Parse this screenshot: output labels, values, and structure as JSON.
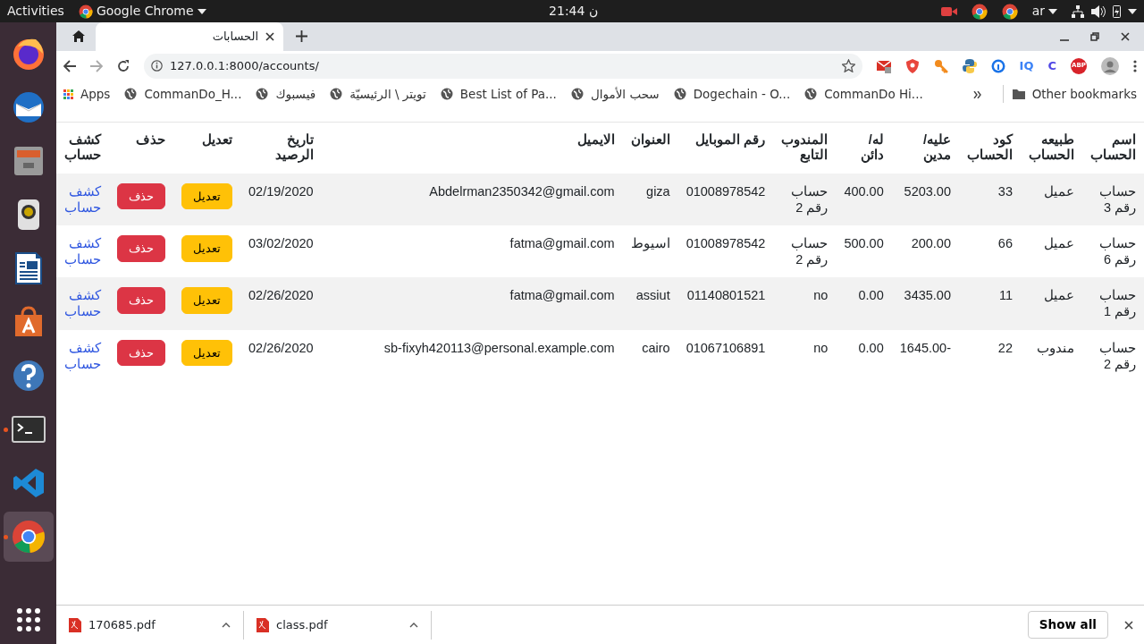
{
  "top_bar": {
    "activities": "Activities",
    "app": "Google Chrome",
    "clock": "ن 21:44",
    "language": "ar"
  },
  "dock": {
    "items": [
      {
        "kind": "firefox",
        "running": false,
        "selected": false
      },
      {
        "kind": "mail",
        "running": false,
        "selected": false
      },
      {
        "kind": "files",
        "running": false,
        "selected": false
      },
      {
        "kind": "speaker",
        "running": false,
        "selected": false
      },
      {
        "kind": "writer",
        "running": false,
        "selected": false
      },
      {
        "kind": "store",
        "running": false,
        "selected": false
      },
      {
        "kind": "help",
        "running": false,
        "selected": false
      },
      {
        "kind": "terminal",
        "running": true,
        "selected": false
      },
      {
        "kind": "code",
        "running": false,
        "selected": false
      },
      {
        "kind": "chrome",
        "running": true,
        "selected": true
      }
    ]
  },
  "tabs": [
    {
      "label": "الحسابات",
      "selected": true
    }
  ],
  "address": "127.0.0.1:8000/accounts/",
  "extensions": [
    {
      "kind": "stop",
      "label": "ABP",
      "color": "#d8232a"
    },
    {
      "kind": "label",
      "label": "C",
      "color": "#4f46e5"
    },
    {
      "kind": "label",
      "label": "IQ",
      "color": "#3b82f6"
    },
    {
      "kind": "info"
    },
    {
      "kind": "python"
    },
    {
      "kind": "key"
    },
    {
      "kind": "shield"
    },
    {
      "kind": "mail"
    }
  ],
  "bookmarks": {
    "apps": "Apps",
    "items": [
      "CommanDo Hi...",
      "Dogechain - O...",
      "سحب الأموال",
      "Best List of Pa...",
      "تويتر \\ الرئيسيّة",
      "فيسبوك",
      "CommanDo_H..."
    ],
    "other": "Other bookmarks"
  },
  "table": {
    "columns": [
      "اسم الحساب",
      "طبيعه الحساب",
      "كود الحساب",
      "عليه/ مدين",
      "له/ دائن",
      "المندوب التابع",
      "رقم الموبايل",
      "العنوان",
      "الايميل",
      "تاريخ الرصيد",
      "تعديل",
      "حذف",
      "كشف حساب"
    ],
    "rows": [
      {
        "cells": [
          "حساب رقم 3",
          "عميل",
          "33",
          "5203.00",
          "400.00",
          "حساب رقم 2",
          "01008978542",
          "giza",
          "Abdelrman2350342@gmail.com",
          "02/19/2020"
        ],
        "edit": "تعديل",
        "delete": "حذف",
        "statement": "كشف حساب"
      },
      {
        "cells": [
          "حساب رقم 6",
          "عميل",
          "66",
          "200.00",
          "500.00",
          "حساب رقم 2",
          "01008978542",
          "اسيوط",
          "fatma@gmail.com",
          "03/02/2020"
        ],
        "edit": "تعديل",
        "delete": "حذف",
        "statement": "كشف حساب"
      },
      {
        "cells": [
          "حساب رقم 1",
          "عميل",
          "11",
          "3435.00",
          "0.00",
          "no",
          "01140801521",
          "assiut",
          "fatma@gmail.com",
          "02/26/2020"
        ],
        "edit": "تعديل",
        "delete": "حذف",
        "statement": "كشف حساب"
      },
      {
        "cells": [
          "حساب رقم 2",
          "مندوب",
          "22",
          "1645.00-",
          "0.00",
          "no",
          "01067106891",
          "cairo",
          "sb-fixyh420113@personal.example.com",
          "02/26/2020"
        ],
        "edit": "تعديل",
        "delete": "حذف",
        "statement": "كشف حساب"
      }
    ]
  },
  "downloads": {
    "files": [
      "class.pdf",
      "170685.pdf"
    ],
    "show_all": "Show all"
  }
}
